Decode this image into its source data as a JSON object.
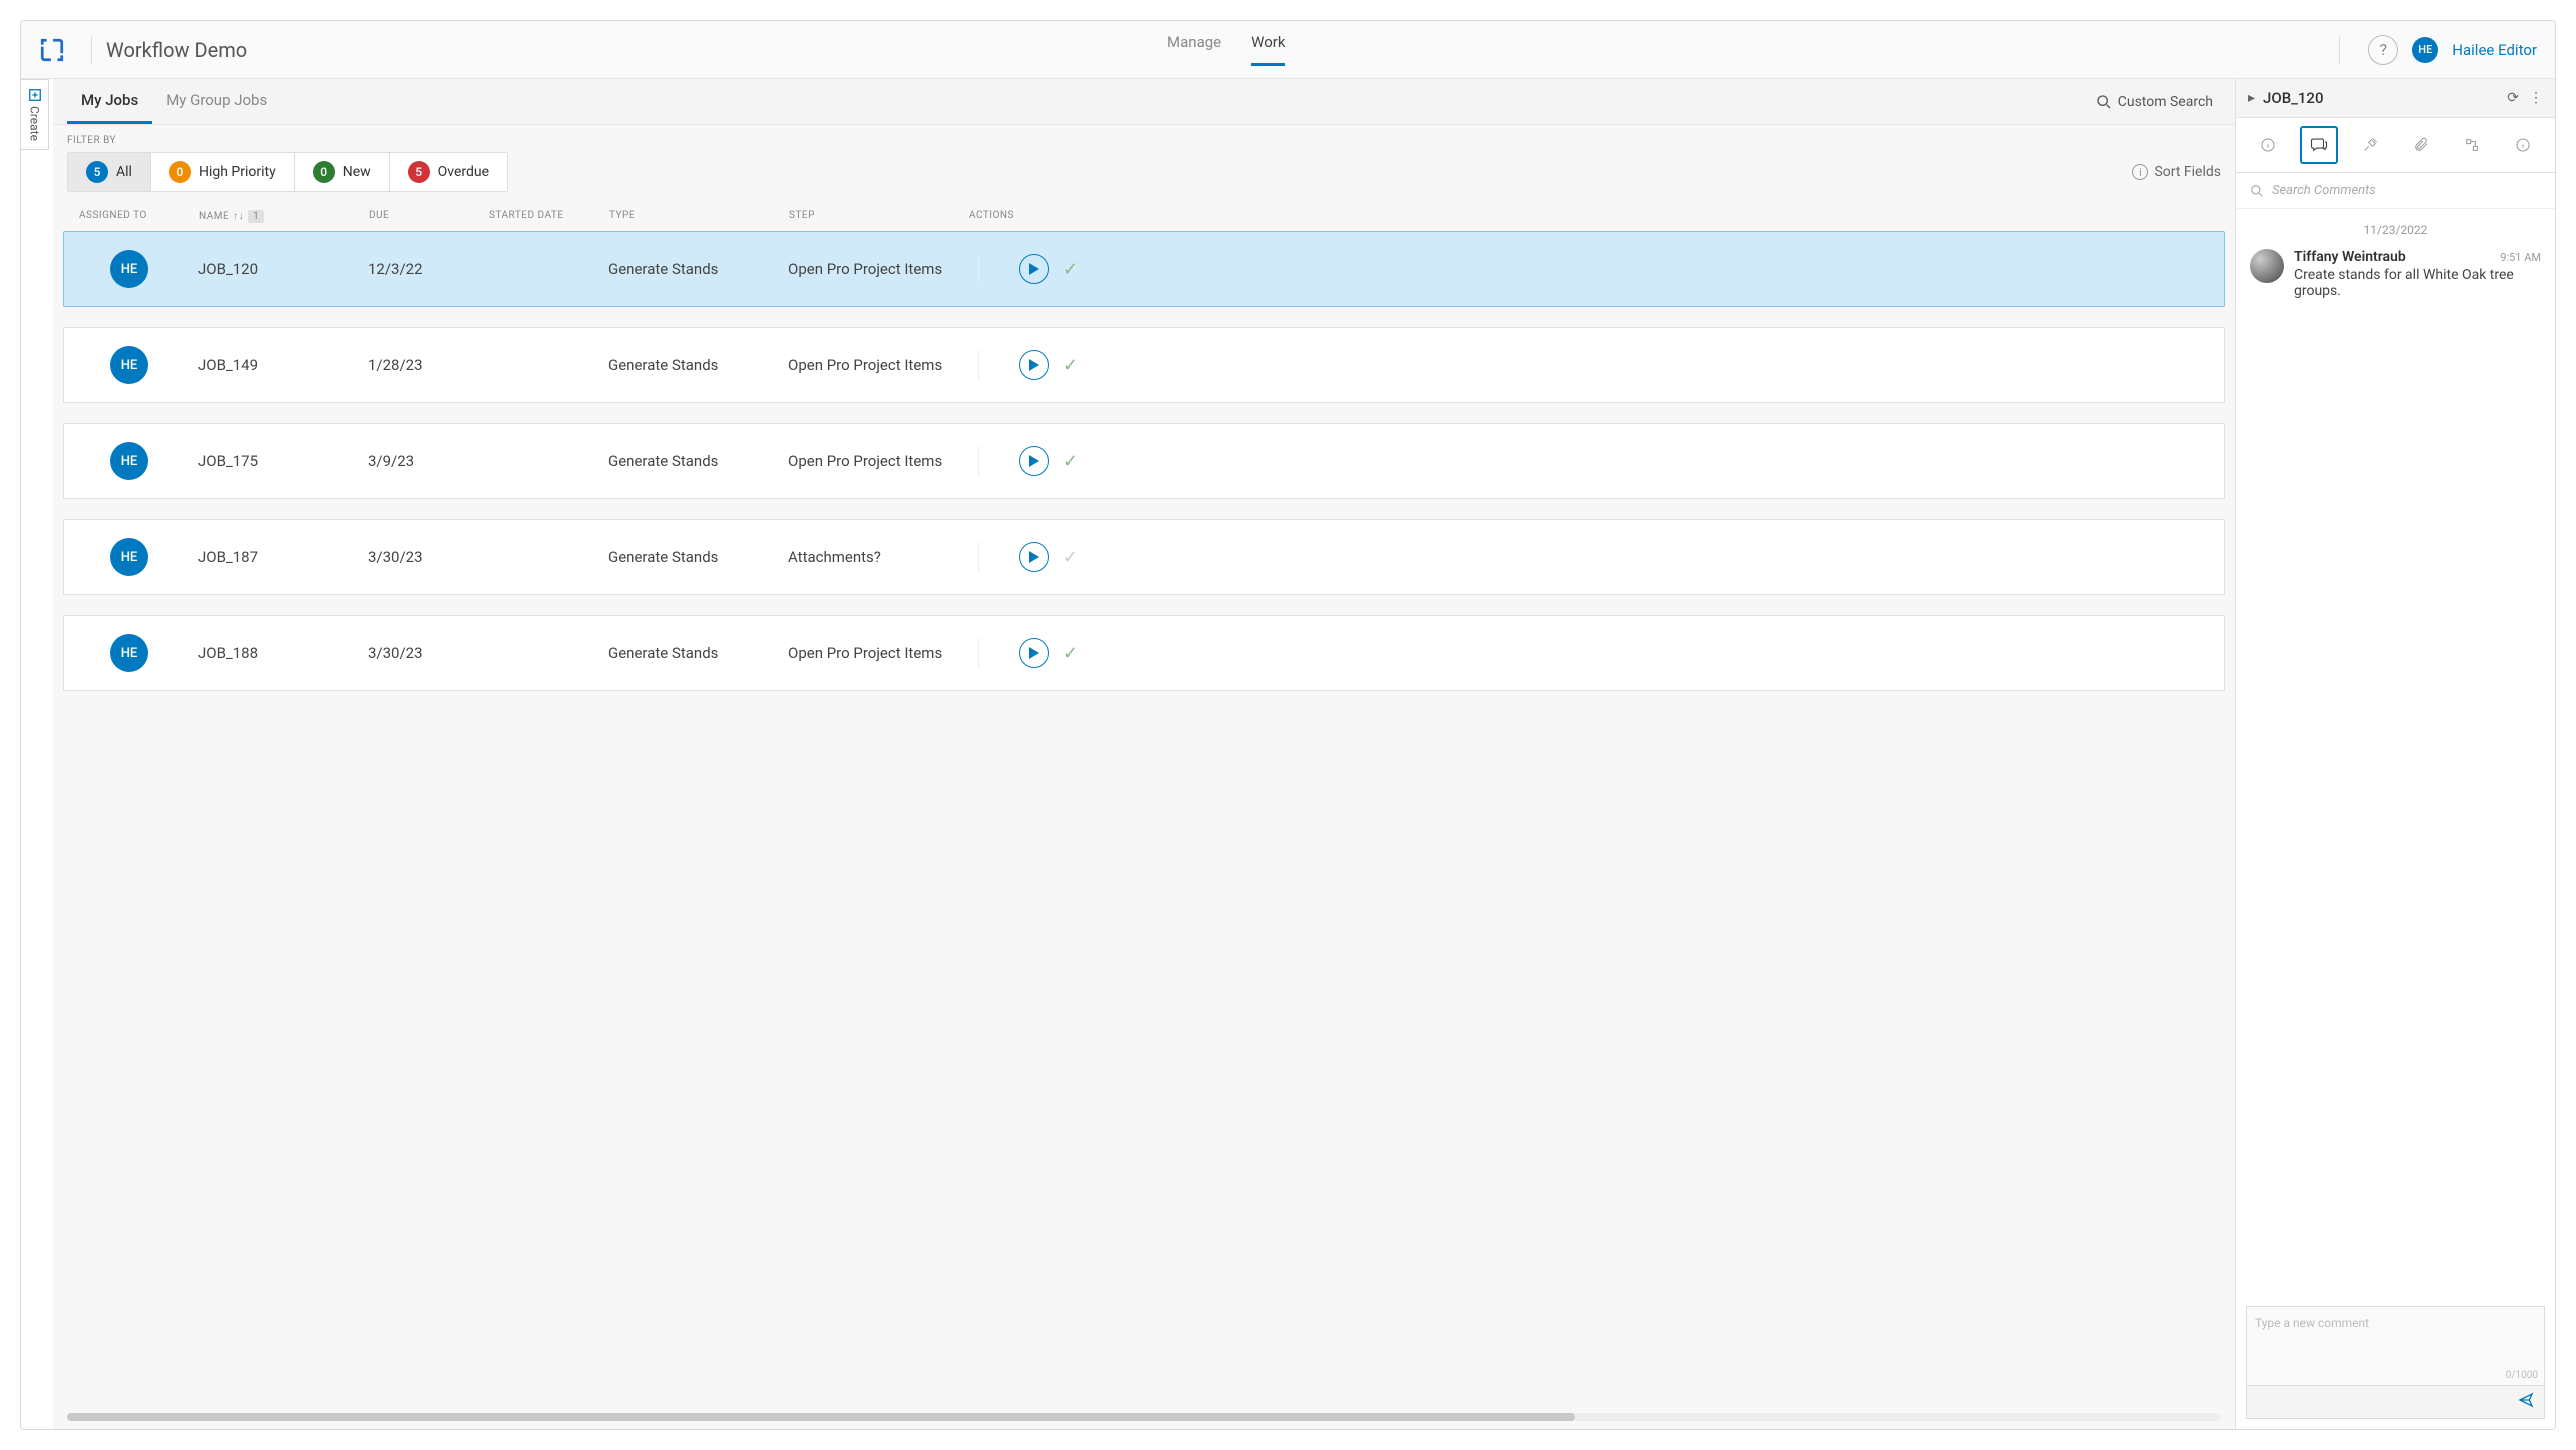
{
  "header": {
    "app_title": "Workflow Demo",
    "nav": {
      "manage": "Manage",
      "work": "Work"
    },
    "user": {
      "initials": "HE",
      "name": "Hailee Editor"
    }
  },
  "create_tab": "Create",
  "tabs": {
    "my_jobs": "My Jobs",
    "my_group_jobs": "My Group Jobs"
  },
  "custom_search": "Custom Search",
  "filter_by_label": "FILTER BY",
  "filters": {
    "all": {
      "count": "5",
      "label": "All"
    },
    "high": {
      "count": "0",
      "label": "High Priority"
    },
    "new": {
      "count": "0",
      "label": "New"
    },
    "overdue": {
      "count": "5",
      "label": "Overdue"
    }
  },
  "sort_fields": "Sort Fields",
  "columns": {
    "assigned": "ASSIGNED TO",
    "name": "NAME",
    "due": "DUE",
    "started": "STARTED DATE",
    "type": "TYPE",
    "step": "STEP",
    "actions": "ACTIONS",
    "sort_num": "1"
  },
  "jobs": [
    {
      "initials": "HE",
      "name": "JOB_120",
      "due": "12/3/22",
      "type": "Generate Stands",
      "step": "Open Pro Project Items",
      "check_muted": false
    },
    {
      "initials": "HE",
      "name": "JOB_149",
      "due": "1/28/23",
      "type": "Generate Stands",
      "step": "Open Pro Project Items",
      "check_muted": false
    },
    {
      "initials": "HE",
      "name": "JOB_175",
      "due": "3/9/23",
      "type": "Generate Stands",
      "step": "Open Pro Project Items",
      "check_muted": false
    },
    {
      "initials": "HE",
      "name": "JOB_187",
      "due": "3/30/23",
      "type": "Generate Stands",
      "step": "Attachments?",
      "check_muted": true
    },
    {
      "initials": "HE",
      "name": "JOB_188",
      "due": "3/30/23",
      "type": "Generate Stands",
      "step": "Open Pro Project Items",
      "check_muted": false
    }
  ],
  "detail": {
    "title": "JOB_120",
    "search_placeholder": "Search Comments",
    "date_divider": "11/23/2022",
    "comment": {
      "author": "Tiffany Weintraub",
      "time": "9:51 AM",
      "text": "Create stands for all White Oak tree groups."
    },
    "new_comment_placeholder": "Type a new comment",
    "char_count": "0/1000"
  }
}
